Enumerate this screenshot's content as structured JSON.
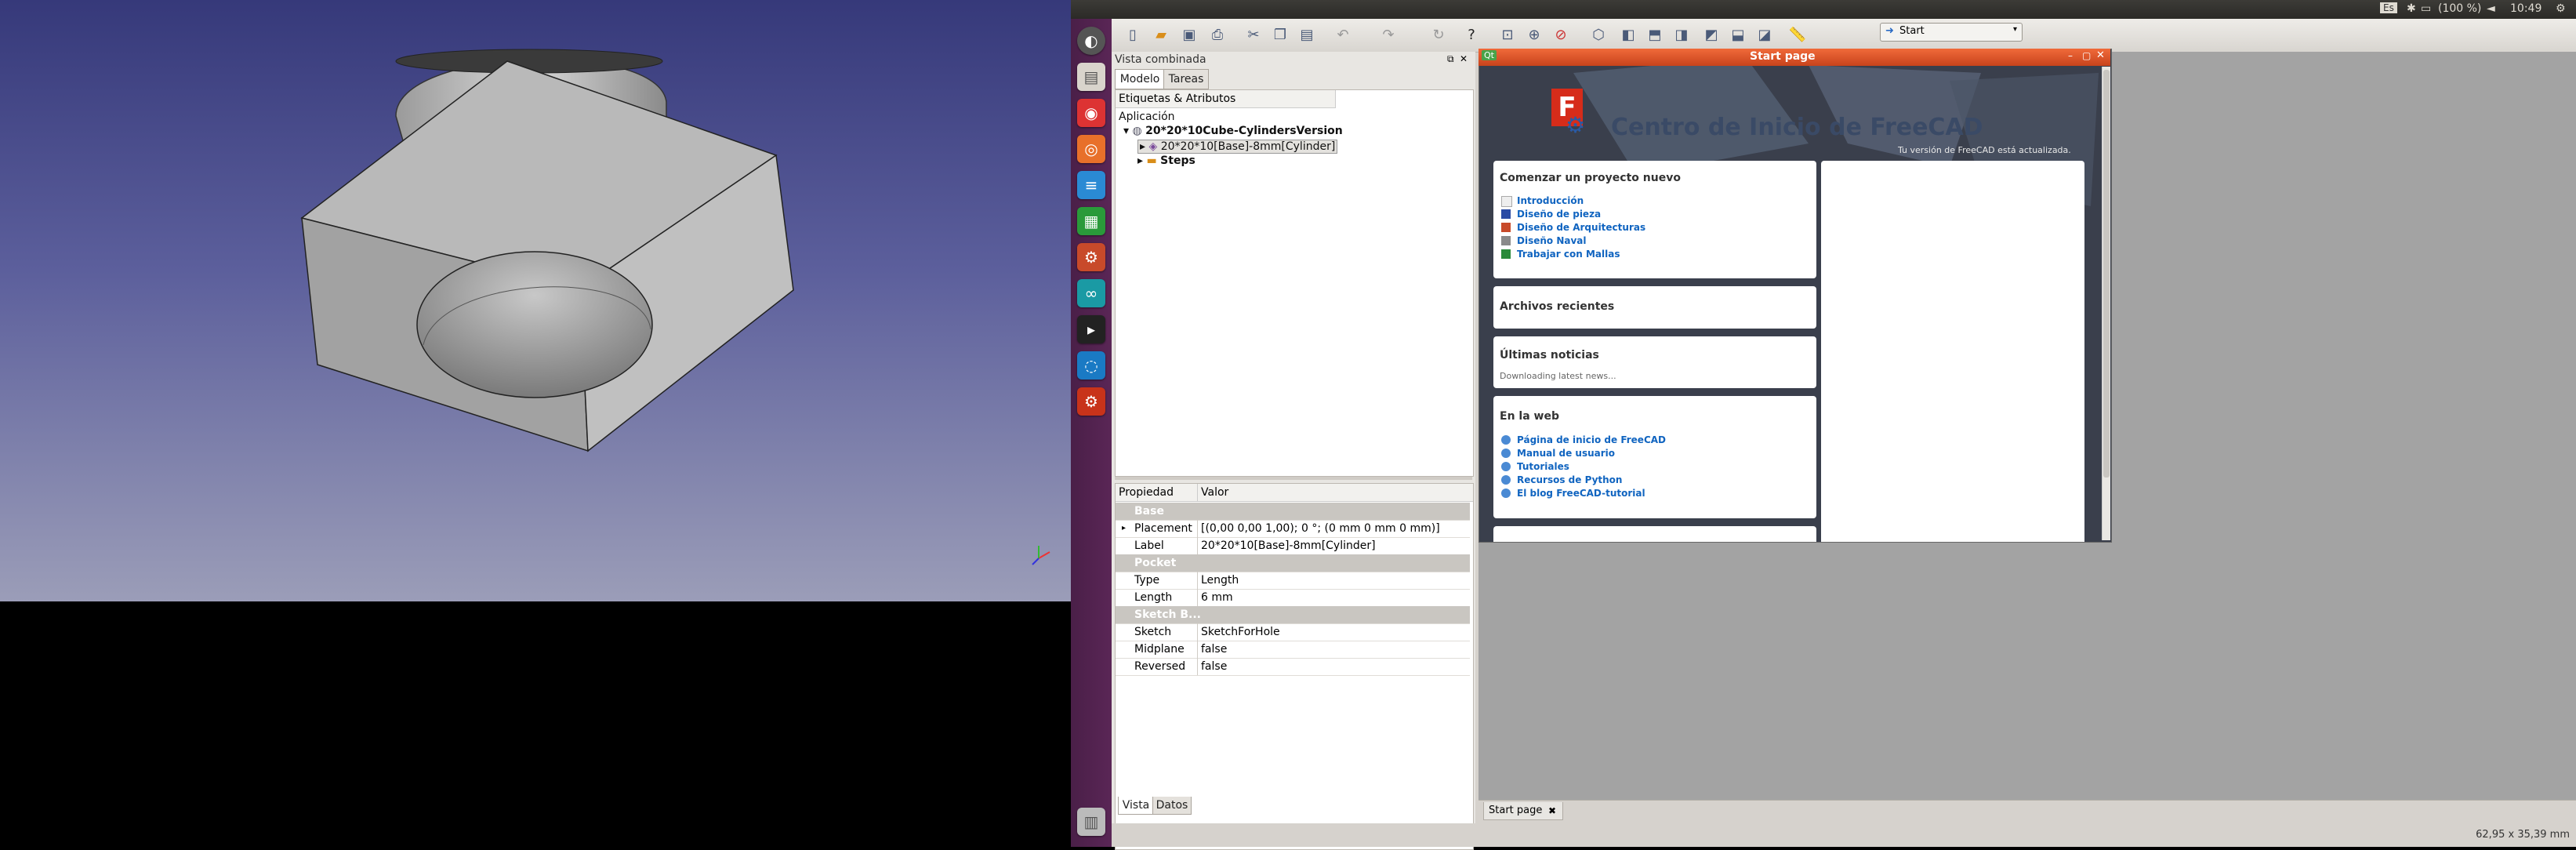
{
  "topbar": {
    "keyboard": "Es",
    "battery": "(100 %)",
    "clock": "10:49"
  },
  "combo_view": {
    "title": "Vista combinada",
    "tabs": [
      "Modelo",
      "Tareas"
    ],
    "labels_header": "Etiquetas & Atributos",
    "application_label": "Aplicación",
    "tree": [
      {
        "label": "20*20*10Cube-CylindersVersion",
        "level": 0,
        "expanded": true
      },
      {
        "label": "20*20*10[Base]-8mm[Cylinder]",
        "level": 1,
        "selected": true
      },
      {
        "label": "Steps",
        "level": 1
      }
    ],
    "property_header": {
      "key": "Propiedad",
      "value": "Valor"
    },
    "properties": [
      {
        "group": "Base"
      },
      {
        "key": "Placement",
        "value": "[(0,00 0,00 1,00); 0 °; (0 mm  0 mm  0 mm)]",
        "expandable": true
      },
      {
        "key": "Label",
        "value": "20*20*10[Base]-8mm[Cylinder]"
      },
      {
        "group": "Pocket"
      },
      {
        "key": "Type",
        "value": "Length"
      },
      {
        "key": "Length",
        "value": "6 mm"
      },
      {
        "group": "Sketch B..."
      },
      {
        "key": "Sketch",
        "value": "SketchForHole"
      },
      {
        "key": "Midplane",
        "value": "false"
      },
      {
        "key": "Reversed",
        "value": "false"
      }
    ],
    "bottom_tabs": [
      "Vista",
      "Datos"
    ]
  },
  "toolbar": {
    "workbench": "Start"
  },
  "start_page": {
    "window_title": "Start page",
    "qt_badge": "Qt",
    "heading": "Centro de Inicio de FreeCAD",
    "version_note": "Tu versión de FreeCAD está actualizada.",
    "sections": {
      "new_project": {
        "title": "Comenzar un proyecto nuevo",
        "links": [
          "Introducción",
          "Diseño de pieza",
          "Diseño de Arquitecturas",
          "Diseño Naval",
          "Trabajar con Mallas"
        ]
      },
      "recent": {
        "title": "Archivos recientes"
      },
      "news": {
        "title": "Últimas noticias",
        "text": "Downloading latest news..."
      },
      "web": {
        "title": "En la web",
        "links": [
          "Página de inicio de FreeCAD",
          "Manual de usuario",
          "Tutoriales",
          "Recursos de Python",
          "El blog FreeCAD-tutorial"
        ]
      }
    }
  },
  "doc_tab": {
    "label": "Start page"
  },
  "statusbar": {
    "dimensions": "62,95 x 35,39 mm"
  },
  "colors": {
    "launcher": "#5a2656",
    "titlebar": "#e05a2a",
    "link": "#1064c0",
    "viewport_top": "#36397a",
    "viewport_bottom": "#9b9db8"
  }
}
